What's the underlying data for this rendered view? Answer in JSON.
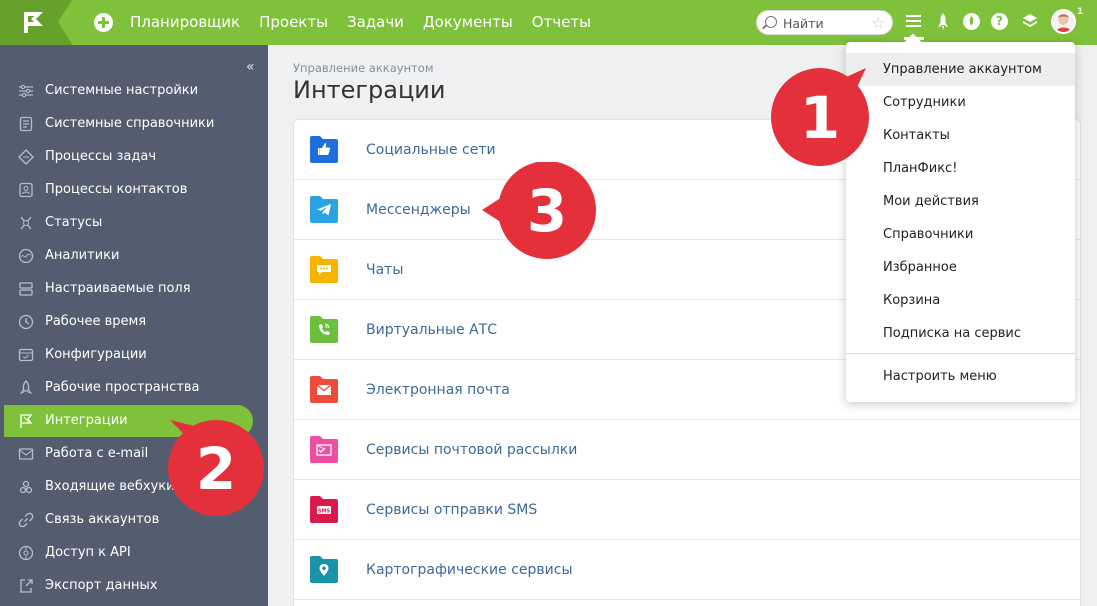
{
  "topbar": {
    "nav": [
      "Планировщик",
      "Проекты",
      "Задачи",
      "Документы",
      "Отчеты"
    ],
    "search_placeholder": "Найти",
    "notification_count": "1",
    "icons": [
      "flag-logo-icon",
      "add-icon",
      "search-icon",
      "star-icon",
      "menu-icon",
      "rocket-icon",
      "leaf-icon",
      "help-icon",
      "layers-icon",
      "avatar"
    ]
  },
  "sidebar": {
    "collapse_label": "«",
    "items": [
      {
        "label": "Системные настройки",
        "icon": "sliders-icon"
      },
      {
        "label": "Системные справочники",
        "icon": "book-icon"
      },
      {
        "label": "Процессы задач",
        "icon": "diamond-icon"
      },
      {
        "label": "Процессы контактов",
        "icon": "contact-process-icon"
      },
      {
        "label": "Статусы",
        "icon": "status-icon"
      },
      {
        "label": "Аналитики",
        "icon": "analytics-icon"
      },
      {
        "label": "Настраиваемые поля",
        "icon": "fields-icon"
      },
      {
        "label": "Рабочее время",
        "icon": "clock-icon"
      },
      {
        "label": "Конфигурации",
        "icon": "config-icon"
      },
      {
        "label": "Рабочие пространства",
        "icon": "rocket-icon"
      },
      {
        "label": "Интеграции",
        "icon": "integration-flag-icon"
      },
      {
        "label": "Работа с e-mail",
        "icon": "mail-icon"
      },
      {
        "label": "Входящие вебхуки",
        "icon": "webhook-icon"
      },
      {
        "label": "Связь аккаунтов",
        "icon": "link-icon"
      },
      {
        "label": "Доступ к API",
        "icon": "api-icon"
      },
      {
        "label": "Экспорт данных",
        "icon": "export-icon"
      }
    ],
    "active_index": 10
  },
  "main": {
    "breadcrumb": "Управление аккаунтом",
    "title": "Интеграции",
    "rows": [
      {
        "label": "Социальные сети",
        "color": "#1e6fd9",
        "icon": "thumbs-up-icon"
      },
      {
        "label": "Мессенджеры",
        "color": "#2aa3e0",
        "icon": "telegram-icon"
      },
      {
        "label": "Чаты",
        "color": "#f4b400",
        "icon": "chat-bubble-icon"
      },
      {
        "label": "Виртуальные АТС",
        "color": "#6cbf3c",
        "icon": "phone-icon"
      },
      {
        "label": "Электронная почта",
        "color": "#ee4b3b",
        "icon": "envelope-icon"
      },
      {
        "label": "Сервисы почтовой рассылки",
        "color": "#ef4fa0",
        "icon": "newsletter-icon"
      },
      {
        "label": "Сервисы отправки SMS",
        "color": "#d81b4c",
        "icon": "sms-icon"
      },
      {
        "label": "Картографические сервисы",
        "color": "#1a93a6",
        "icon": "map-pin-icon"
      }
    ]
  },
  "dropdown": {
    "items": [
      "Управление аккаунтом",
      "Сотрудники",
      "Контакты",
      "ПланФикс!",
      "Мои действия",
      "Справочники",
      "Избранное",
      "Корзина",
      "Подписка на сервис"
    ],
    "footer_item": "Настроить меню",
    "highlighted_index": 0
  },
  "markers": [
    "1",
    "2",
    "3"
  ],
  "colors": {
    "accent": "#7fc13b",
    "sidebar": "#545d6f",
    "marker": "#e3303a",
    "link": "#3c6a9a"
  }
}
